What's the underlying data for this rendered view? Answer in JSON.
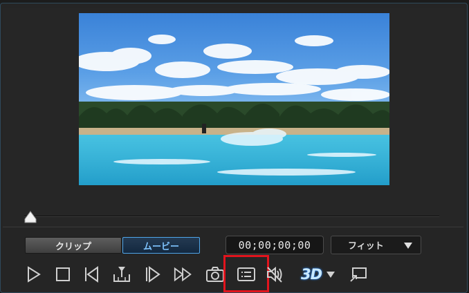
{
  "player": {
    "mode_tabs": [
      {
        "label": "クリップ",
        "active": false
      },
      {
        "label": "ムービー",
        "active": true
      }
    ],
    "timecode": "00;00;00;00",
    "zoom_select": {
      "selected": "フィット"
    },
    "seek_position": 0.0
  },
  "controls": {
    "play": "play-icon",
    "stop": "stop-icon",
    "prev_frame": "previous-frame-icon",
    "split": "split-clip-icon",
    "next_frame": "next-frame-icon",
    "fast_forward": "fast-forward-icon",
    "snapshot": "camera-icon",
    "chapter_list": "list-icon",
    "volume": "volume-icon",
    "three_d_label": "3D",
    "three_d_menu": "chevron-down-icon",
    "external_display": "external-display-icon"
  },
  "colors": {
    "accent": "#4fa6ea",
    "highlight": "#e2141d"
  }
}
